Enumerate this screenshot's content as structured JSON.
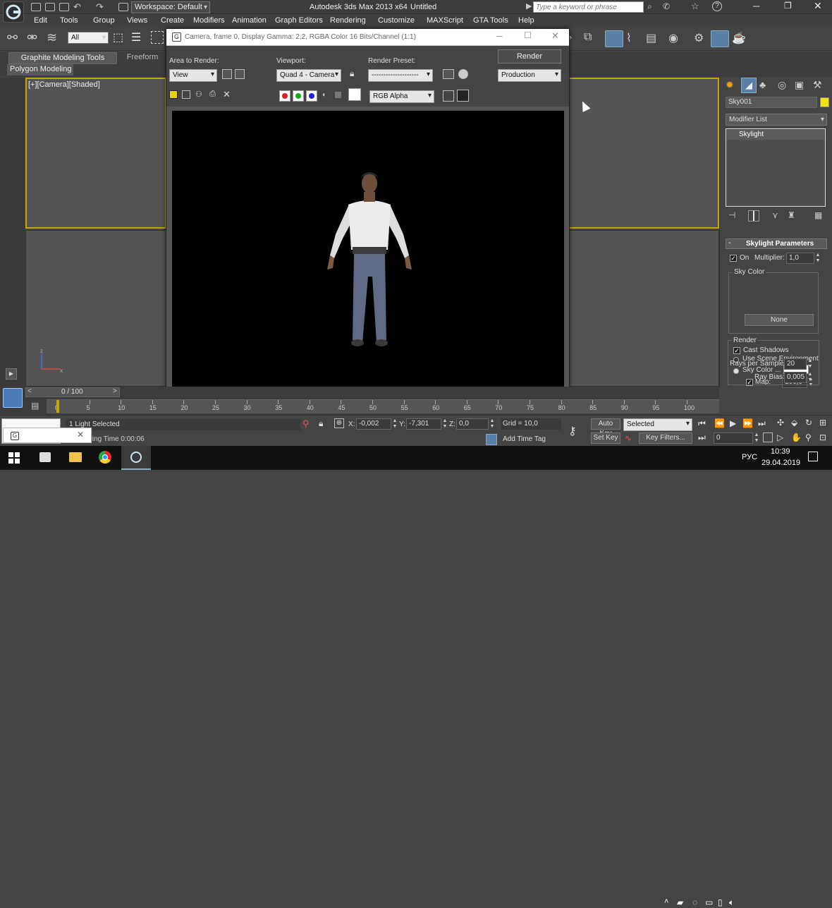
{
  "title_bar": {
    "workspace": "Workspace: Default",
    "app_title": "Autodesk 3ds Max  2013 x64",
    "doc_title": "Untitled",
    "search_placeholder": "Type a keyword or phrase"
  },
  "menu": [
    "Edit",
    "Tools",
    "Group",
    "Views",
    "Create",
    "Modifiers",
    "Animation",
    "Graph Editors",
    "Rendering",
    "Customize",
    "MAXScript",
    "GTA Tools",
    "Help"
  ],
  "toolbar": {
    "selection_filter": "All"
  },
  "ribbon": {
    "tabs": [
      "Graphite Modeling Tools",
      "Freeform"
    ],
    "sub": "Polygon Modeling"
  },
  "viewport": {
    "label": "[+][Camera][Shaded]",
    "axis_z": "z",
    "axis_x": "x"
  },
  "render_window": {
    "title": "Camera, frame 0, Display Gamma: 2,2, RGBA Color 16 Bits/Channel (1:1)",
    "area_label": "Area to Render:",
    "area_value": "View",
    "viewport_label": "Viewport:",
    "viewport_value": "Quad 4 - Camera",
    "preset_label": "Render Preset:",
    "preset_value": "--------------------",
    "render_button": "Render",
    "production_value": "Production",
    "channel_value": "RGB Alpha"
  },
  "command_panel": {
    "object_name": "Sky001",
    "object_color": "#f5e20a",
    "modifier_list": "Modifier List",
    "stack_item": "Skylight",
    "rollout_title": "Skylight Parameters",
    "on_label": "On",
    "multiplier_label": "Multiplier:",
    "multiplier_value": "1,0",
    "sky_color_group": "Sky Color",
    "use_scene_env": "Use Scene Environment",
    "sky_color_label": "Sky Color ...",
    "map_label": "Map:",
    "map_value": "100,0",
    "map_button": "None",
    "render_group": "Render",
    "cast_shadows": "Cast Shadows",
    "rays_label": "Rays per Sample:",
    "rays_value": "20",
    "ray_bias_label": "Ray Bias:",
    "ray_bias_value": "0,005"
  },
  "timeline": {
    "slider": "0 / 100",
    "ticks": [
      "0",
      "5",
      "10",
      "15",
      "20",
      "25",
      "30",
      "35",
      "40",
      "45",
      "50",
      "55",
      "60",
      "65",
      "70",
      "75",
      "80",
      "85",
      "90",
      "95",
      "100"
    ]
  },
  "status": {
    "selection": "1 Light Selected",
    "prompt": "Rendering Time  0:00:06",
    "x_label": "X:",
    "x_value": "-0,002",
    "y_label": "Y:",
    "y_value": "-7,301",
    "z_label": "Z:",
    "z_value": "0,0",
    "grid": "Grid = 10,0",
    "add_time_tag": "Add Time Tag",
    "auto_key": "Auto Key",
    "set_key": "Set Key",
    "selected_value": "Selected",
    "key_filters": "Key Filters...",
    "frame_value": "0"
  },
  "taskbar": {
    "lang": "РУС",
    "time": "10:39",
    "date": "29.04.2019"
  }
}
